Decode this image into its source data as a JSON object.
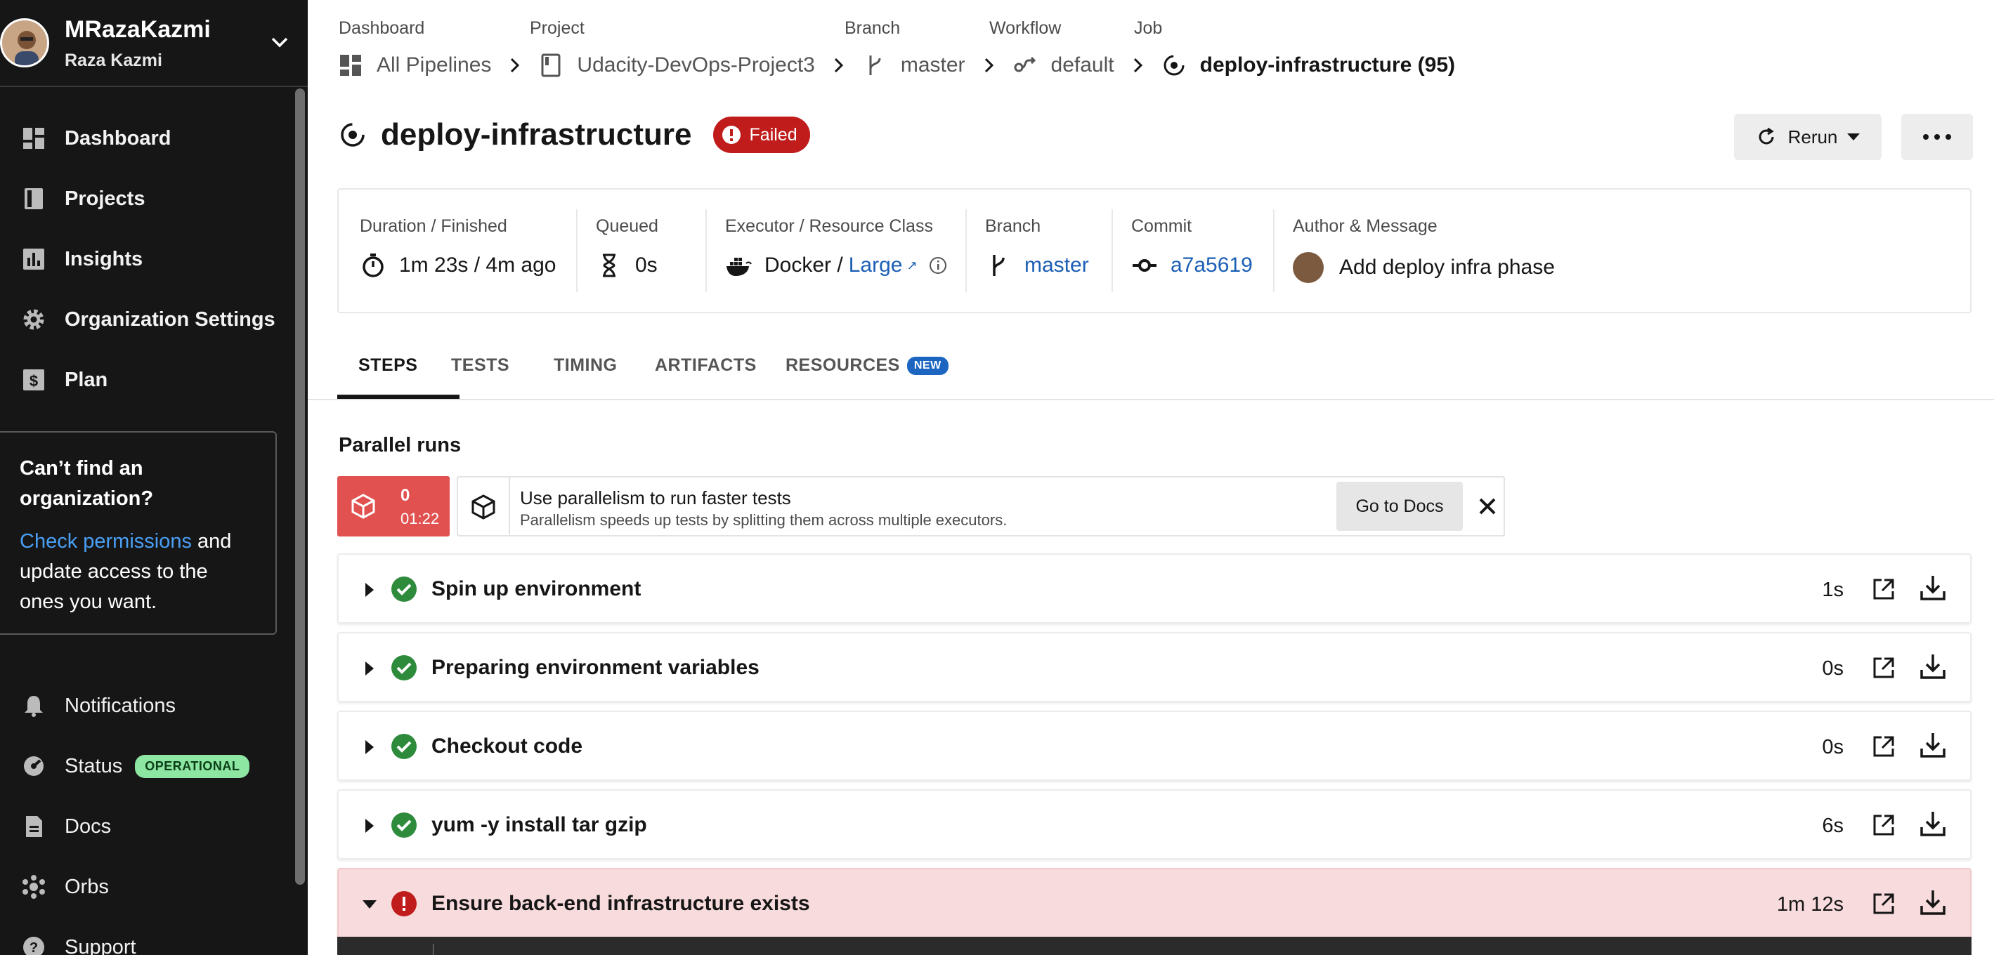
{
  "user": {
    "handle": "MRazaKazmi",
    "full_name": "Raza Kazmi"
  },
  "nav": {
    "items": [
      {
        "label": "Dashboard",
        "icon": "dashboard-icon"
      },
      {
        "label": "Projects",
        "icon": "projects-icon"
      },
      {
        "label": "Insights",
        "icon": "insights-icon"
      },
      {
        "label": "Organization Settings",
        "icon": "gear-icon"
      },
      {
        "label": "Plan",
        "icon": "dollar-icon"
      }
    ],
    "bottom": [
      {
        "label": "Notifications",
        "icon": "bell-icon"
      },
      {
        "label": "Status",
        "icon": "status-icon",
        "badge": "OPERATIONAL"
      },
      {
        "label": "Docs",
        "icon": "docs-icon"
      },
      {
        "label": "Orbs",
        "icon": "orbs-icon"
      },
      {
        "label": "Support",
        "icon": "support-icon"
      }
    ]
  },
  "promo": {
    "title": "Can’t find an organization?",
    "link": "Check permissions",
    "body": " and update access to the ones you want."
  },
  "breadcrumb": {
    "labels": [
      "Dashboard",
      "Project",
      "Branch",
      "Workflow",
      "Job"
    ],
    "values": [
      "All Pipelines",
      "Udacity-DevOps-Project3",
      "master",
      "default",
      "deploy-infrastructure (95)"
    ]
  },
  "job": {
    "name": "deploy-infrastructure",
    "status": "Failed"
  },
  "actions": {
    "rerun": "Rerun"
  },
  "meta": {
    "duration_label": "Duration / Finished",
    "duration_value": "1m 23s / 4m ago",
    "queued_label": "Queued",
    "queued_value": "0s",
    "executor_label": "Executor / Resource Class",
    "executor_value": "Docker / ",
    "resource_class": "Large",
    "branch_label": "Branch",
    "branch_value": "master",
    "commit_label": "Commit",
    "commit_value": "a7a5619",
    "author_label": "Author & Message",
    "author_message": "Add deploy infra phase"
  },
  "tabs": [
    {
      "label": "STEPS",
      "active": true
    },
    {
      "label": "TESTS"
    },
    {
      "label": "TIMING"
    },
    {
      "label": "ARTIFACTS"
    },
    {
      "label": "RESOURCES",
      "badge": "NEW"
    }
  ],
  "parallel": {
    "title": "Parallel runs",
    "run_index": "0",
    "run_time": "01:22",
    "banner_title": "Use parallelism to run faster tests",
    "banner_subtitle": "Parallelism speeds up tests by splitting them across multiple executors.",
    "docs_button": "Go to Docs"
  },
  "steps": [
    {
      "name": "Spin up environment",
      "duration": "1s",
      "status": "success"
    },
    {
      "name": "Preparing environment variables",
      "duration": "0s",
      "status": "success"
    },
    {
      "name": "Checkout code",
      "duration": "0s",
      "status": "success"
    },
    {
      "name": "yum -y install tar gzip",
      "duration": "6s",
      "status": "success"
    },
    {
      "name": "Ensure back-end infrastructure exists",
      "duration": "1m 12s",
      "status": "failed"
    }
  ],
  "colors": {
    "success": "#2e8b3c",
    "failed": "#c01c1c",
    "link": "#1c5fb5",
    "sidebar": "#161616"
  }
}
